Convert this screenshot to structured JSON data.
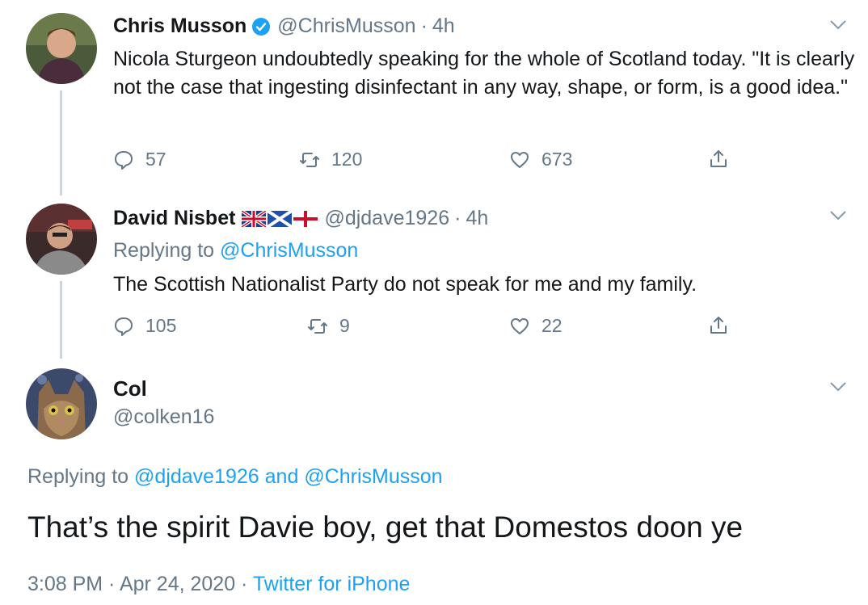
{
  "tweet1": {
    "display_name": "Chris Musson",
    "handle": "@ChrisMusson",
    "sep": "·",
    "time": "4h",
    "text": "Nicola Sturgeon undoubtedly speaking for the whole of Scotland today. \"It is clearly not the case that ingesting disinfectant in any way, shape, or form, is a good idea.\"",
    "replies": "57",
    "retweets": "120",
    "likes": "673"
  },
  "tweet2": {
    "display_name": "David Nisbet",
    "handle": "@djdave1926",
    "sep": "·",
    "time": "4h",
    "replying_prefix": "Replying to",
    "replying_to": "@ChrisMusson",
    "text": "The Scottish Nationalist Party do not speak for me and my family.",
    "replies": "105",
    "retweets": "9",
    "likes": "22"
  },
  "tweet3": {
    "display_name": "Col",
    "handle": "@colken16",
    "replying_prefix": "Replying to",
    "replying_to_1": "@djdave1926",
    "replying_and": "and",
    "replying_to_2": "@ChrisMusson",
    "text": "That’s the spirit Davie boy, get that Domestos doon ye",
    "timestamp": "3:08 PM · Apr 24, 2020 ·",
    "source": "Twitter for iPhone"
  },
  "colors": {
    "text": "#14171a",
    "secondary": "#657786",
    "link": "#1da1f2",
    "verified": "#1da1f2"
  },
  "icons": [
    "reply-icon",
    "retweet-icon",
    "like-icon",
    "share-icon",
    "chevron-down-icon",
    "verified-badge-icon"
  ]
}
